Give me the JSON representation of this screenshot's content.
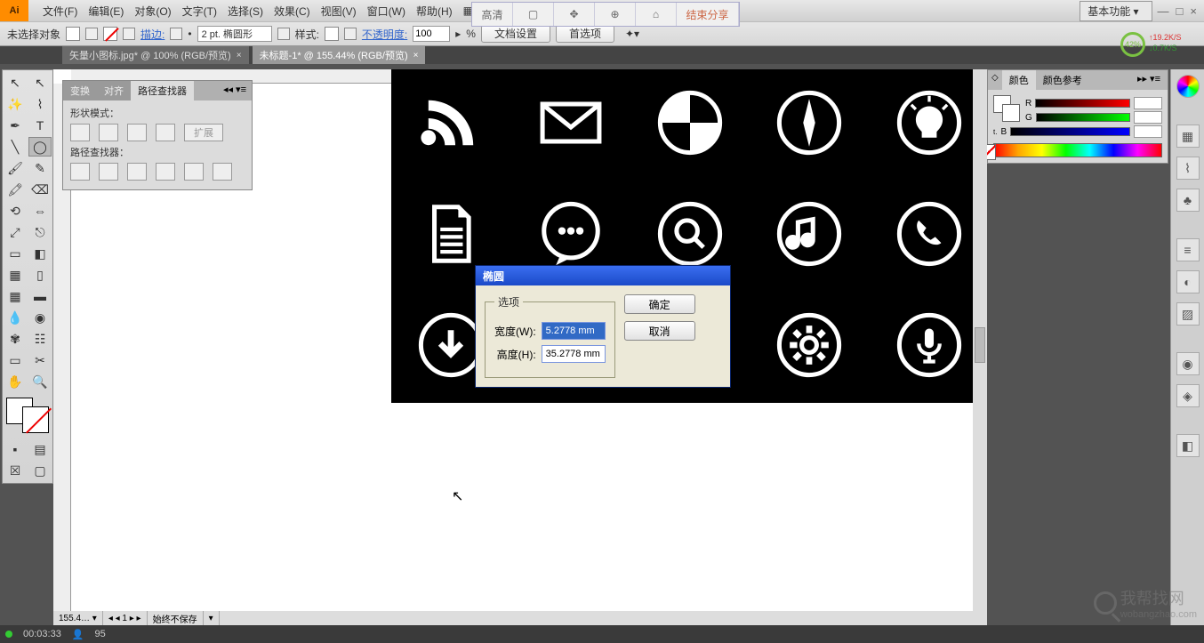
{
  "menu": {
    "items": [
      "文件(F)",
      "编辑(E)",
      "对象(O)",
      "文字(T)",
      "选择(S)",
      "效果(C)",
      "视图(V)",
      "窗口(W)",
      "帮助(H)"
    ],
    "share": {
      "hd": "高清",
      "end": "结束分享"
    },
    "workspace": "基本功能 ▾"
  },
  "optbar": {
    "noselect": "未选择对象",
    "stroke": "描边:",
    "strokeval": "2 pt. 椭圆形",
    "style": "样式:",
    "opacity": "不透明度:",
    "opacityval": "100",
    "pct": "%",
    "docsetup": "文档设置",
    "prefs": "首选项"
  },
  "net": {
    "pct": "42%",
    "up": "19.2K/S",
    "dn": "0.7K/S"
  },
  "tabs": [
    {
      "label": "矢量小图标.jpg* @ 100% (RGB/预览)",
      "active": false
    },
    {
      "label": "未标题-1* @ 155.44% (RGB/预览)",
      "active": true
    }
  ],
  "pathfinder": {
    "tabs": [
      "变换",
      "对齐",
      "路径查找器"
    ],
    "shapeModes": "形状模式：",
    "expand": "扩展",
    "pfLabel": "路径查找器："
  },
  "colorpanel": {
    "tabs": [
      "颜色",
      "颜色参考"
    ],
    "r": "R",
    "g": "G",
    "b": "B",
    "t": "t."
  },
  "dialog": {
    "title": "椭圆",
    "legend": "选项",
    "widthLbl": "宽度(W):",
    "widthVal": "5.2778 mm",
    "heightLbl": "高度(H):",
    "heightVal": "35.2778 mm",
    "ok": "确定",
    "cancel": "取消"
  },
  "status": {
    "time": "00:03:33",
    "viewers": "95",
    "hint": "始终不保存"
  },
  "watermark": {
    "big": "我帮找网",
    "small": "wobangzhao.com"
  },
  "icons": {
    "row": [
      "rss-icon",
      "mail-icon",
      "target-icon",
      "compass-icon",
      "bulb-icon",
      "document-icon",
      "chat-icon",
      "search-circle-icon",
      "music-icon",
      "phone-icon",
      "download-icon",
      "",
      "",
      "gear-circle-icon",
      "mic-icon"
    ]
  }
}
